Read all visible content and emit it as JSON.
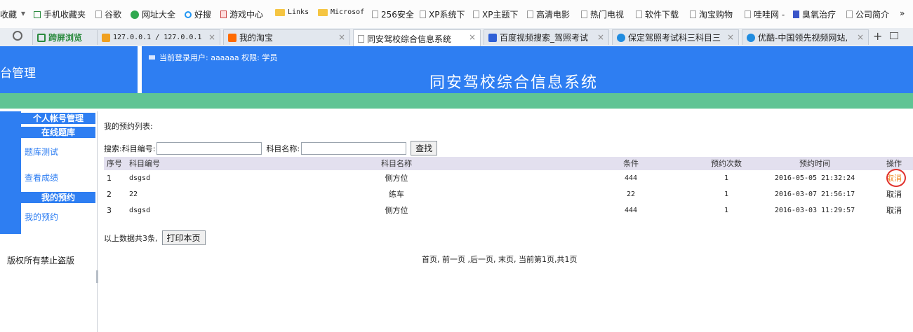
{
  "browser": {
    "bookmarks": [
      {
        "label": "收藏",
        "icon": "none"
      },
      {
        "label": "▾",
        "icon": "none"
      },
      {
        "label": "手机收藏夹",
        "icon": "phone-icon"
      },
      {
        "label": "谷歌",
        "icon": "doc-icon"
      },
      {
        "label": "网址大全",
        "icon": "green-globe-icon"
      },
      {
        "label": "好搜",
        "icon": "search-q-icon"
      },
      {
        "label": "游戏中心",
        "icon": "game-icon"
      },
      {
        "label": "Links",
        "icon": "folder-icon"
      },
      {
        "label": "Microsof",
        "icon": "folder-icon"
      },
      {
        "label": "256安全",
        "icon": "doc-icon"
      },
      {
        "label": "XP系统下",
        "icon": "doc-icon"
      },
      {
        "label": "XP主题下",
        "icon": "doc-icon"
      },
      {
        "label": "高清电影",
        "icon": "doc-icon"
      },
      {
        "label": "热门电视",
        "icon": "doc-icon"
      },
      {
        "label": "软件下载",
        "icon": "doc-icon"
      },
      {
        "label": "淘宝购物",
        "icon": "doc-icon"
      },
      {
        "label": "哇哇网 -",
        "icon": "doc-icon"
      },
      {
        "label": "臭氧治疗",
        "icon": "brand-icon"
      },
      {
        "label": "公司简介",
        "icon": "doc-icon"
      },
      {
        "label": "»",
        "icon": "none"
      }
    ],
    "tabs": [
      {
        "label": "跨屏浏览",
        "active": false,
        "closable": false,
        "icon": "cross-screen-icon",
        "icon_color": "#2a8a3e"
      },
      {
        "label": "127.0.0.1 / 127.0.0.1",
        "active": false,
        "closable": true,
        "icon": "pma-icon",
        "icon_color": "#f0a020"
      },
      {
        "label": "我的淘宝",
        "active": false,
        "closable": true,
        "icon": "taobao-icon",
        "icon_color": "#ff6a00"
      },
      {
        "label": "同安驾校综合信息系统",
        "active": true,
        "closable": true,
        "icon": "doc-icon",
        "icon_color": "#ffffff"
      },
      {
        "label": "百度视频搜索_驾照考试",
        "active": false,
        "closable": true,
        "icon": "baidu-icon",
        "icon_color": "#2e5fd6"
      },
      {
        "label": "保定驾照考试科三科目三",
        "active": false,
        "closable": true,
        "icon": "play-icon",
        "icon_color": "#1f8ce0"
      },
      {
        "label": "优酷-中国领先视频网站,",
        "active": false,
        "closable": true,
        "icon": "play-icon",
        "icon_color": "#1f8ce0"
      }
    ],
    "new_tab_label": "+"
  },
  "header": {
    "left_title": "台管理",
    "user_info": "当前登录用户: aaaaaa 权限:  学员",
    "system_title": "同安驾校综合信息系统"
  },
  "sidebar": {
    "sections": [
      {
        "title": "个人帐号管理",
        "items": []
      },
      {
        "title": "在线题库",
        "items": [
          "题库测试",
          "查看成绩"
        ]
      },
      {
        "title": "我的预约",
        "items": [
          "我的预约"
        ]
      }
    ],
    "copyright": "版权所有禁止盗版"
  },
  "content": {
    "list_title": "我的预约列表:",
    "search": {
      "label": "搜索:",
      "code_label": "科目编号:",
      "name_label": "科目名称:",
      "code_value": "",
      "name_value": "",
      "button": "查找"
    },
    "table": {
      "columns": [
        "序号",
        "科目编号",
        "科目名称",
        "条件",
        "预约次数",
        "预约时间",
        "操作"
      ],
      "rows": [
        {
          "idx": "1",
          "code": "dsgsd",
          "name": "侧方位",
          "cond": "444",
          "count": "1",
          "time": "2016-05-05 21:32:24",
          "op": "取消"
        },
        {
          "idx": "2",
          "code": "22",
          "name": "练车",
          "cond": "22",
          "count": "1",
          "time": "2016-03-07 21:56:17",
          "op": "取消"
        },
        {
          "idx": "3",
          "code": "dsgsd",
          "name": "侧方位",
          "cond": "444",
          "count": "1",
          "time": "2016-03-03 11:29:57",
          "op": "取消"
        }
      ]
    },
    "summary": "以上数据共3条,",
    "print_button": "打印本页",
    "pager": "首页, 前一页 ,后一页, 末页, 当前第1页,共1页"
  }
}
